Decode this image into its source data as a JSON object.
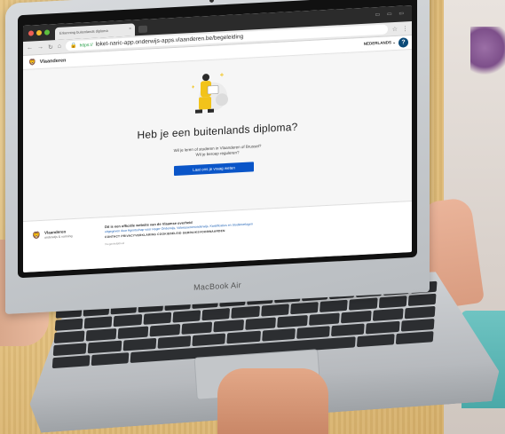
{
  "browser": {
    "tab_title": "Erkenning buitenlands diploma",
    "tab_close": "×",
    "url": "loket-naric-app.onderwijs-apps.vlaanderen.be/begeleiding",
    "url_prefix": "https://",
    "window_buttons": "▭ ▭ ▭"
  },
  "header": {
    "logo_glyph": "🦁",
    "site_name": "Vlaanderen",
    "language": "NEDERLANDS ⌄",
    "help_label": "?"
  },
  "main": {
    "headline": "Heb je een buitenlands diploma?",
    "subtext_line1": "Wil je leren of studeren in Vlaanderen of Brussel?",
    "subtext_line2": "Wil je beroep reguleren?",
    "cta_label": "Laat ons je vraag weten"
  },
  "footer": {
    "logo_glyph": "🦁",
    "brand": "Vlaanderen",
    "brand_sub": "onderwijs & vorming",
    "official": "Dit is een officiële website van de Vlaamse overheid",
    "links_line": "uitgegeven door Agentschap voor Hoger Onderwijs, Volwassenenonderwijs, Kwalificaties en Studietoelagen",
    "nav_links": "CONTACT     PRIVACYVERKLARING     COOKIEBELEID     GEBRUIKSVOORWAARDEN",
    "small_print": "Toegankelijkheid"
  },
  "device": {
    "model": "MacBook Air"
  },
  "colors": {
    "cta_blue": "#0a55c8",
    "help_blue": "#0b4a78",
    "sweater": "#e3c07d"
  }
}
